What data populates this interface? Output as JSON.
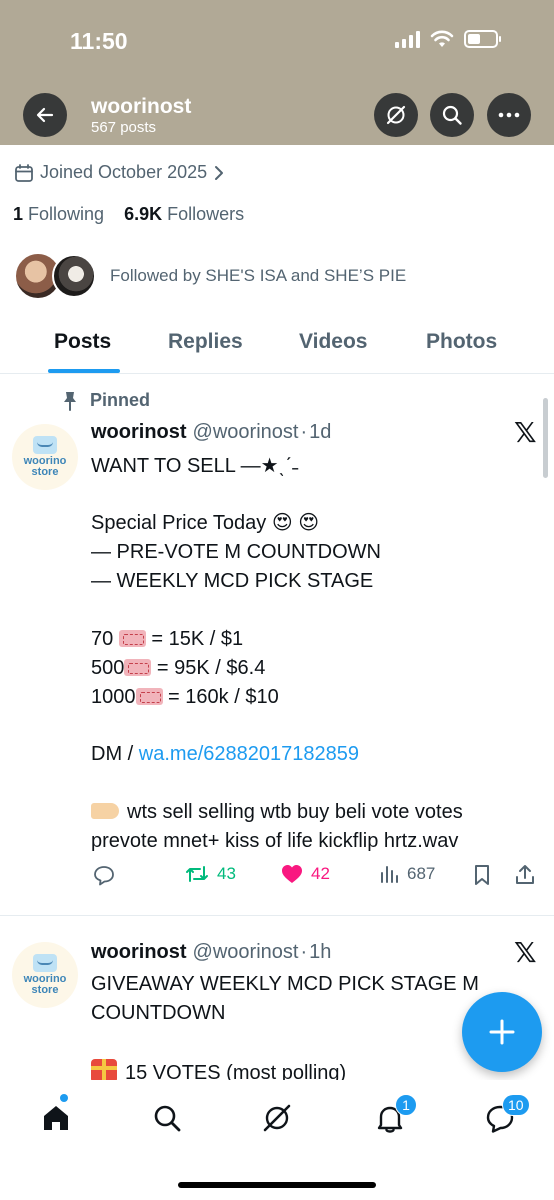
{
  "status_bar": {
    "time": "11:50"
  },
  "header": {
    "name": "woorinost",
    "posts_count": "567 posts",
    "header_bg": "#b1a996"
  },
  "profile": {
    "joined": "Joined October 2025",
    "following_count": "1",
    "following_label": "Following",
    "followers_count": "6.9K",
    "followers_label": "Followers",
    "followed_by": "Followed by SHE'S ISA and SHE’S PIE"
  },
  "tabs": [
    {
      "label": "Posts",
      "active": true
    },
    {
      "label": "Replies",
      "active": false
    },
    {
      "label": "Videos",
      "active": false
    },
    {
      "label": "Photos",
      "active": false
    }
  ],
  "posts": [
    {
      "pinned_label": "Pinned",
      "avatar_text": [
        "woorino",
        "store"
      ],
      "name": "woorinost",
      "handle": "@woorinost",
      "dot": "·",
      "time": "1d",
      "lines": {
        "l1": "WANT TO SELL —★ˎˊ˗",
        "l2": "Special Price Today 😍 😍",
        "l3": "— PRE-VOTE M COUNTDOWN",
        "l4": "— WEEKLY MCD PICK STAGE",
        "l5a": "70 ",
        "l5b": " = 15K / $1",
        "l6a": "500",
        "l6b": " = 95K / $6.4",
        "l7a": "1000",
        "l7b": " = 160k / $10",
        "l8a": "DM / ",
        "l8b": "wa.me/62882017182859",
        "l9": "wts sell selling wtb buy beli vote votes",
        "l10": "prevote mnet+ kiss of life kickflip hrtz.wav"
      },
      "stats": {
        "reposts": "43",
        "likes": "42",
        "views": "687"
      }
    },
    {
      "avatar_text": [
        "woorino",
        "store"
      ],
      "name": "woorinost",
      "handle": "@woorinost",
      "dot": "·",
      "time": "1h",
      "lines": {
        "l1": "GIVEAWAY WEEKLY MCD PICK STAGE M",
        "l2": "COUNTDOWN",
        "l3": "15 VOTES (most polling)"
      }
    }
  ],
  "bottom_nav": {
    "notifications_badge": "1",
    "messages_badge": "10"
  },
  "colors": {
    "accent": "#1d9bf0",
    "repost": "#00ba7c",
    "like": "#f91880",
    "text_secondary": "#536471"
  }
}
